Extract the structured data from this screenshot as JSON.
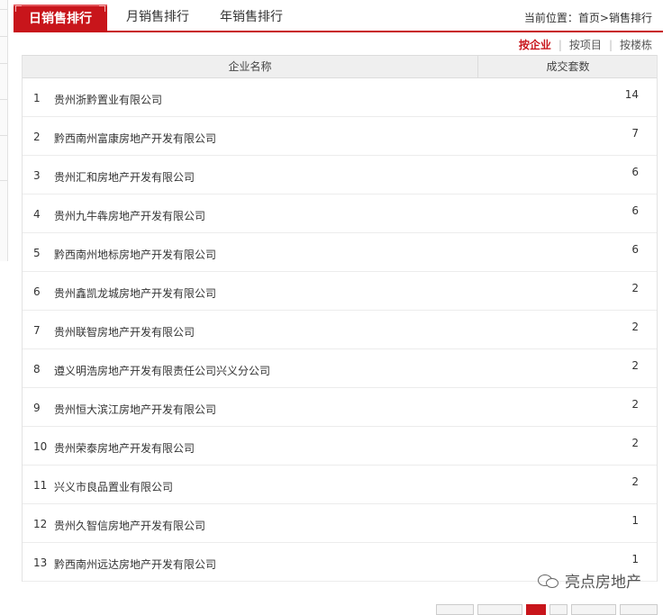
{
  "tabs": [
    {
      "label": "日销售排行",
      "active": true
    },
    {
      "label": "月销售排行",
      "active": false
    },
    {
      "label": "年销售排行",
      "active": false
    }
  ],
  "breadcrumb": {
    "prefix": "当前位置：",
    "home": "首页",
    "sep": ">",
    "current": "销售排行"
  },
  "sort_options": [
    {
      "label": "按企业",
      "active": true
    },
    {
      "label": "按项目",
      "active": false
    },
    {
      "label": "按楼栋",
      "active": false
    }
  ],
  "table": {
    "headers": {
      "name": "企业名称",
      "count": "成交套数"
    },
    "rows": [
      {
        "rank": "1",
        "name": "贵州浙黔置业有限公司",
        "count": "14"
      },
      {
        "rank": "2",
        "name": "黔西南州富康房地产开发有限公司",
        "count": "7"
      },
      {
        "rank": "3",
        "name": "贵州汇和房地产开发有限公司",
        "count": "6"
      },
      {
        "rank": "4",
        "name": "贵州九牛犇房地产开发有限公司",
        "count": "6"
      },
      {
        "rank": "5",
        "name": "黔西南州地标房地产开发有限公司",
        "count": "6"
      },
      {
        "rank": "6",
        "name": "贵州鑫凯龙城房地产开发有限公司",
        "count": "2"
      },
      {
        "rank": "7",
        "name": "贵州联智房地产开发有限公司",
        "count": "2"
      },
      {
        "rank": "8",
        "name": "遵义明浩房地产开发有限责任公司兴义分公司",
        "count": "2"
      },
      {
        "rank": "9",
        "name": "贵州恒大滨江房地产开发有限公司",
        "count": "2"
      },
      {
        "rank": "10",
        "name": "贵州荣泰房地产开发有限公司",
        "count": "2"
      },
      {
        "rank": "11",
        "name": "兴义市良品置业有限公司",
        "count": "2"
      },
      {
        "rank": "12",
        "name": "贵州久智信房地产开发有限公司",
        "count": "1"
      },
      {
        "rank": "13",
        "name": "黔西南州远达房地产开发有限公司",
        "count": "1"
      }
    ]
  },
  "watermark": {
    "text": "亮点房地产",
    "icon": "wechat-icon"
  },
  "colors": {
    "accent": "#c8151b",
    "header_bg": "#efefef"
  }
}
